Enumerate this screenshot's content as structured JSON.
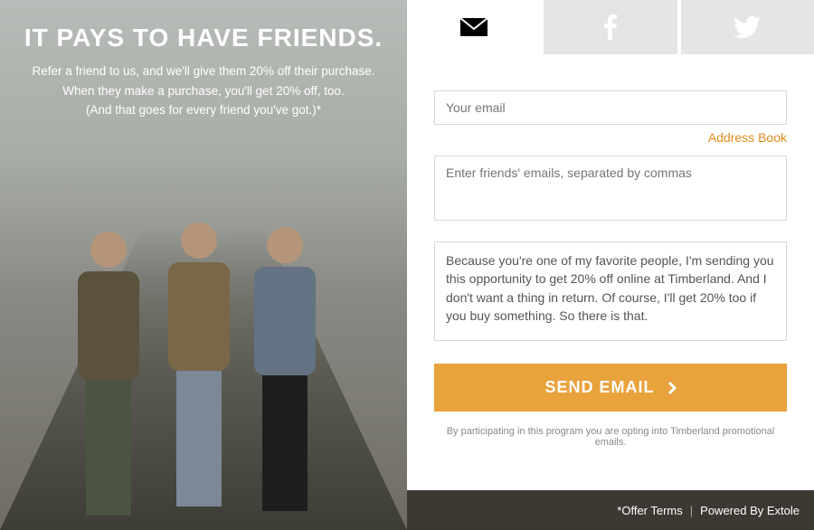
{
  "hero": {
    "title": "IT PAYS TO HAVE FRIENDS.",
    "line1": "Refer a friend to us, and we'll give them 20% off their purchase.",
    "line2": "When they make a purchase, you'll get 20% off, too.",
    "line3": "(And that goes for every friend you've got.)*"
  },
  "tabs": {
    "email": "email",
    "facebook": "facebook",
    "twitter": "twitter"
  },
  "form": {
    "email_placeholder": "Your email",
    "address_book": "Address Book",
    "friends_placeholder": "Enter friends' emails, separated by commas",
    "message_value": "Because you're one of my favorite people, I'm sending you this opportunity to get 20% off online at Timberland. And I don't want a thing in return. Of course, I'll get 20% too if you buy something. So there is that.",
    "send_button": "SEND EMAIL",
    "disclaimer": "By participating in this program you are opting into Timberland promotional emails."
  },
  "footer": {
    "offer_terms": "*Offer Terms",
    "powered_by": "Powered By Extole"
  },
  "colors": {
    "accent": "#e8a33d",
    "link": "#e38b1e",
    "footer_bg": "#3d3832"
  }
}
